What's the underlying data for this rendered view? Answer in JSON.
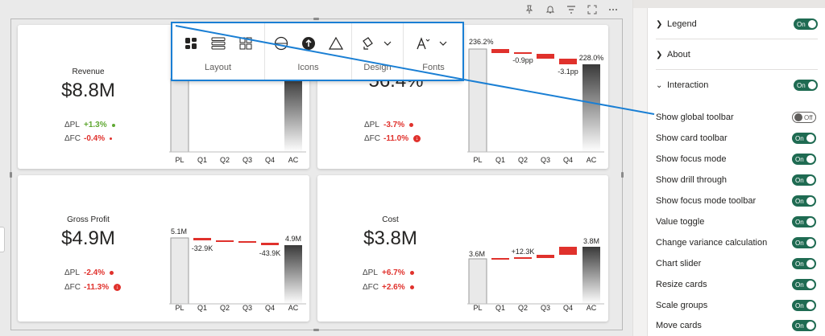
{
  "header_icons": [
    "pin-icon",
    "bell-icon",
    "filter-icon",
    "focus-mode-icon",
    "more-options-icon"
  ],
  "toolbar": {
    "groups": [
      {
        "label": "Layout",
        "icons": [
          "grid-layout-icon",
          "rows-layout-icon",
          "tiles-layout-icon"
        ]
      },
      {
        "label": "Icons",
        "icons": [
          "circle-outline-icon",
          "circle-arrow-icon",
          "triangle-icon"
        ]
      },
      {
        "label": "Design",
        "icons": [
          "paint-bucket-icon"
        ]
      },
      {
        "label": "Fonts",
        "icons": [
          "font-size-icon"
        ]
      }
    ]
  },
  "cards": [
    {
      "title": "Revenue",
      "value": "$8.8M",
      "variances": [
        {
          "label": "ΔPL",
          "value": "+1.3%",
          "sentiment": "positive"
        },
        {
          "label": "ΔFC",
          "value": "-0.4%",
          "sentiment": "negative"
        }
      ],
      "chart_labels": {
        "pl": "",
        "steps": [
          "",
          "",
          "",
          ""
        ],
        "ac": ""
      },
      "categories": [
        "PL",
        "Q1",
        "Q2",
        "Q3",
        "Q4",
        "AC"
      ]
    },
    {
      "title": "",
      "value": "56.4%",
      "variances": [
        {
          "label": "ΔPL",
          "value": "-3.7%",
          "sentiment": "negative"
        },
        {
          "label": "ΔFC",
          "value": "-11.0%",
          "sentiment": "negative"
        }
      ],
      "chart_labels": {
        "pl": "236.2%",
        "steps": [
          "",
          "-0.9pp",
          "",
          "-3.1pp"
        ],
        "ac": "228.0%"
      },
      "categories": [
        "PL",
        "Q1",
        "Q2",
        "Q3",
        "Q4",
        "AC"
      ]
    },
    {
      "title": "Gross Profit",
      "value": "$4.9M",
      "variances": [
        {
          "label": "ΔPL",
          "value": "-2.4%",
          "sentiment": "negative"
        },
        {
          "label": "ΔFC",
          "value": "-11.3%",
          "sentiment": "negative"
        }
      ],
      "chart_labels": {
        "pl": "5.1M",
        "steps": [
          "-32.9K",
          "",
          "",
          "-43.9K"
        ],
        "ac": "4.9M"
      },
      "categories": [
        "PL",
        "Q1",
        "Q2",
        "Q3",
        "Q4",
        "AC"
      ]
    },
    {
      "title": "Cost",
      "value": "$3.8M",
      "variances": [
        {
          "label": "ΔPL",
          "value": "+6.7%",
          "sentiment": "negative"
        },
        {
          "label": "ΔFC",
          "value": "+2.6%",
          "sentiment": "negative"
        }
      ],
      "chart_labels": {
        "pl": "3.6M",
        "steps": [
          "",
          "+12.3K",
          "",
          ""
        ],
        "ac": "3.8M"
      },
      "categories": [
        "PL",
        "Q1",
        "Q2",
        "Q3",
        "Q4",
        "AC"
      ]
    }
  ],
  "chart_data": [
    {
      "type": "bar",
      "title": "Revenue",
      "categories": [
        "PL",
        "Q1",
        "Q2",
        "Q3",
        "Q4",
        "AC"
      ],
      "values": [
        null,
        null,
        null,
        null,
        null,
        null
      ]
    },
    {
      "type": "bar",
      "title": "",
      "categories": [
        "PL",
        "Q1",
        "Q2",
        "Q3",
        "Q4",
        "AC"
      ],
      "values": [
        236.2,
        null,
        -0.9,
        null,
        -3.1,
        228.0
      ]
    },
    {
      "type": "bar",
      "title": "Gross Profit",
      "categories": [
        "PL",
        "Q1",
        "Q2",
        "Q3",
        "Q4",
        "AC"
      ],
      "values": [
        5.1,
        -32.9,
        null,
        null,
        -43.9,
        4.9
      ]
    },
    {
      "type": "bar",
      "title": "Cost",
      "categories": [
        "PL",
        "Q1",
        "Q2",
        "Q3",
        "Q4",
        "AC"
      ],
      "values": [
        3.6,
        null,
        12.3,
        null,
        null,
        3.8
      ]
    }
  ],
  "pane": {
    "sections": [
      {
        "label": "Legend",
        "toggle": "On",
        "chevron": ">"
      },
      {
        "label": "About",
        "chevron": ">"
      },
      {
        "label": "Interaction",
        "toggle": "On",
        "chevron": "v"
      }
    ],
    "properties": [
      {
        "label": "Show global toolbar",
        "toggle": "Off"
      },
      {
        "label": "Show card toolbar",
        "toggle": "On"
      },
      {
        "label": "Show focus mode",
        "toggle": "On"
      },
      {
        "label": "Show drill through",
        "toggle": "On"
      },
      {
        "label": "Show focus mode toolbar",
        "toggle": "On"
      },
      {
        "label": "Value toggle",
        "toggle": "On"
      },
      {
        "label": "Change variance calculation",
        "toggle": "On"
      },
      {
        "label": "Chart slider",
        "toggle": "On"
      },
      {
        "label": "Resize cards",
        "toggle": "On"
      },
      {
        "label": "Scale groups",
        "toggle": "On"
      },
      {
        "label": "Move cards",
        "toggle": "On"
      }
    ]
  },
  "colors": {
    "accent": "#1a7fd4",
    "toggle_on": "#1f6b52",
    "positive": "#5fa832",
    "negative": "#e0312c"
  }
}
